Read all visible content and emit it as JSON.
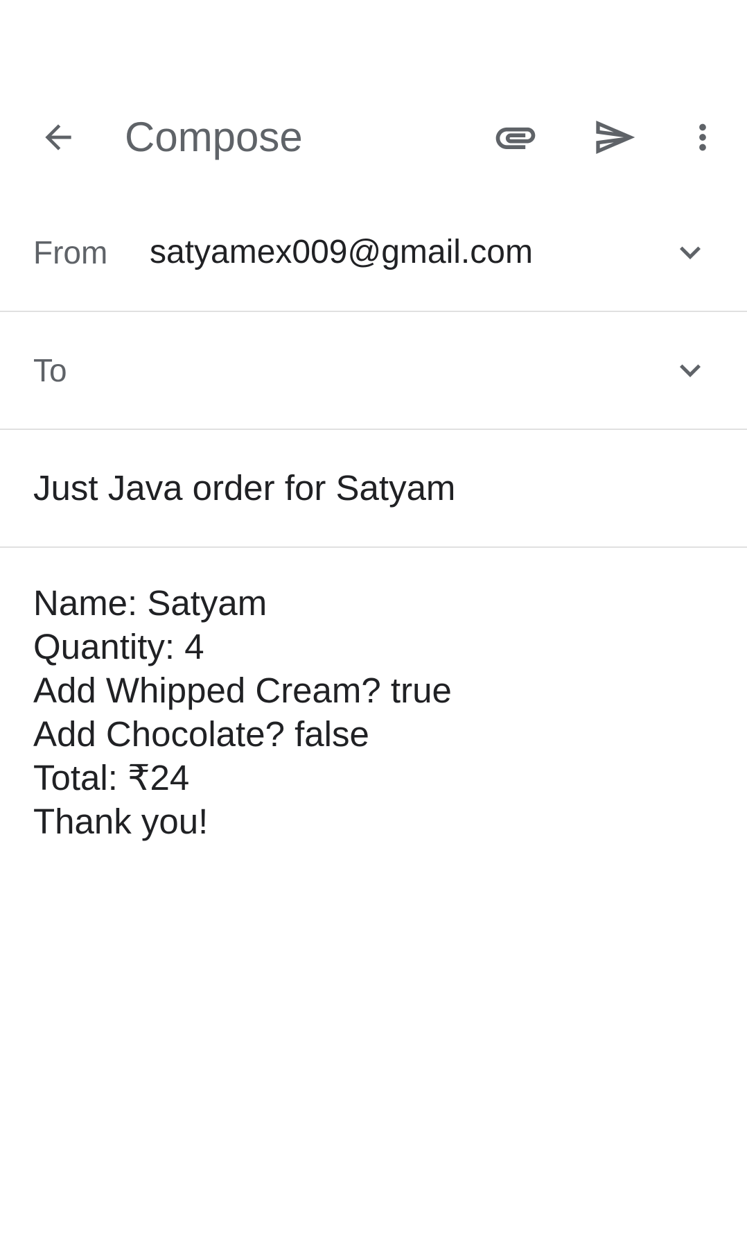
{
  "toolbar": {
    "title": "Compose",
    "icons": [
      "back-arrow-icon",
      "attachment-icon",
      "send-icon",
      "more-vert-icon"
    ]
  },
  "from": {
    "label": "From",
    "value": "satyamex009@gmail.com"
  },
  "to": {
    "label": "To",
    "value": ""
  },
  "subject": {
    "value": "Just Java order for Satyam"
  },
  "body": {
    "lines": [
      "Name: Satyam",
      "Quantity: 4",
      "Add Whipped Cream? true",
      "Add Chocolate? false",
      "Total: ₹24",
      "Thank you!"
    ]
  },
  "colors": {
    "icon": "#5f6368",
    "text": "#202124",
    "divider": "#e0e0e0",
    "background": "#ffffff"
  }
}
